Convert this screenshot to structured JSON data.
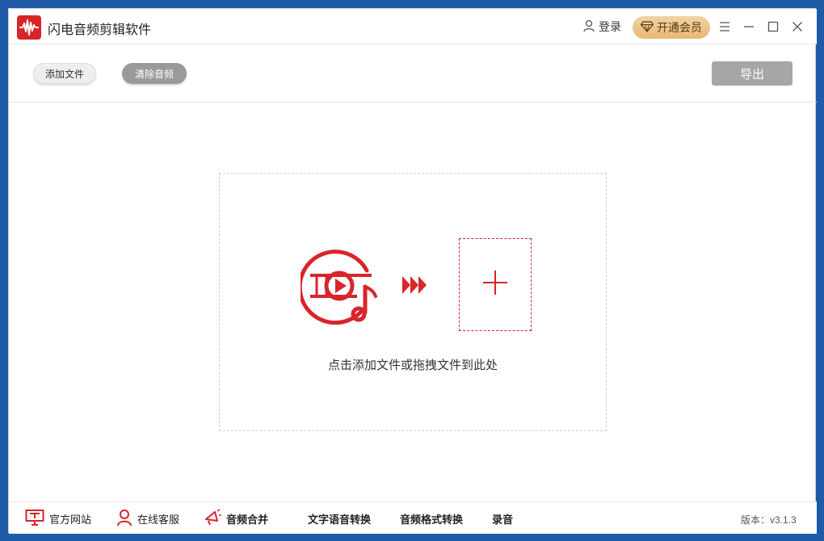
{
  "app": {
    "title": "闪电音频剪辑软件",
    "accent": "#d8252a"
  },
  "titlebar": {
    "login_label": "登录",
    "vip_label": "开通会员",
    "menu_icon": "menu-icon",
    "minimize_icon": "minimize-icon",
    "maximize_icon": "maximize-icon",
    "close_icon": "close-icon"
  },
  "toolbar": {
    "add_file_label": "添加文件",
    "clear_audio_label": "清除音频",
    "export_label": "导出"
  },
  "dropzone": {
    "hint": "点击添加文件或拖拽文件到此处"
  },
  "footer": {
    "items": [
      {
        "label": "官方网站",
        "icon": "monitor-icon"
      },
      {
        "label": "在线客服",
        "icon": "user-icon"
      },
      {
        "label": "音频合并",
        "icon": "megaphone-icon"
      },
      {
        "label": "文字语音转换"
      },
      {
        "label": "音频格式转换"
      },
      {
        "label": "录音"
      }
    ],
    "version": "版本：v3.1.3"
  }
}
